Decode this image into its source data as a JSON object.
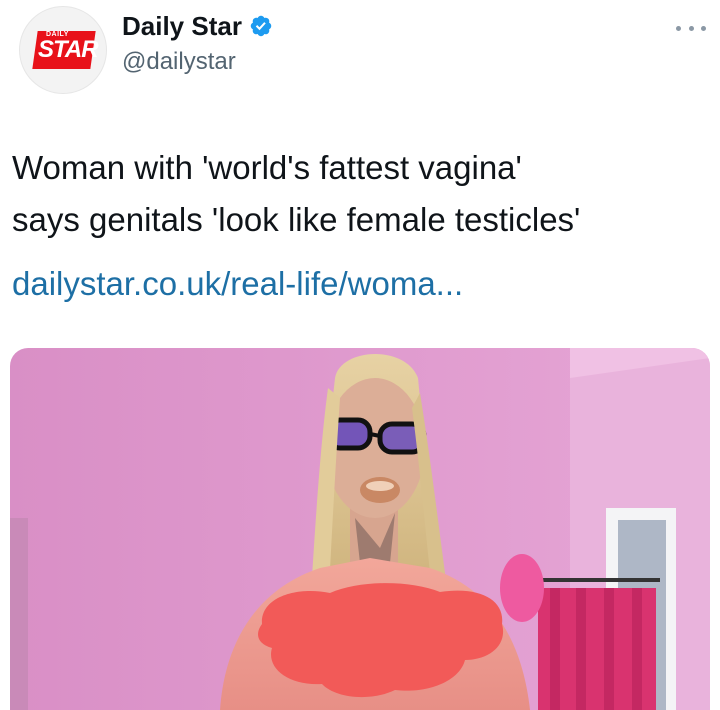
{
  "account": {
    "display_name": "Daily Star",
    "handle": "@dailystar",
    "verified": true,
    "avatar_logo_small": "DAILY",
    "avatar_logo_big": "STAR"
  },
  "tweet": {
    "line1": "Woman with 'world's fattest vagina'",
    "line2": "says genitals 'look like female testicles'",
    "link": "dailystar.co.uk/real-life/woma..."
  },
  "icons": {
    "verified": "verified-badge-icon",
    "more": "more-options-icon"
  },
  "colors": {
    "link": "#1d6fa5",
    "handle": "#536471",
    "verified": "#1d9bf0",
    "brand_red": "#e8121a",
    "censor_red": "#f25a58"
  }
}
